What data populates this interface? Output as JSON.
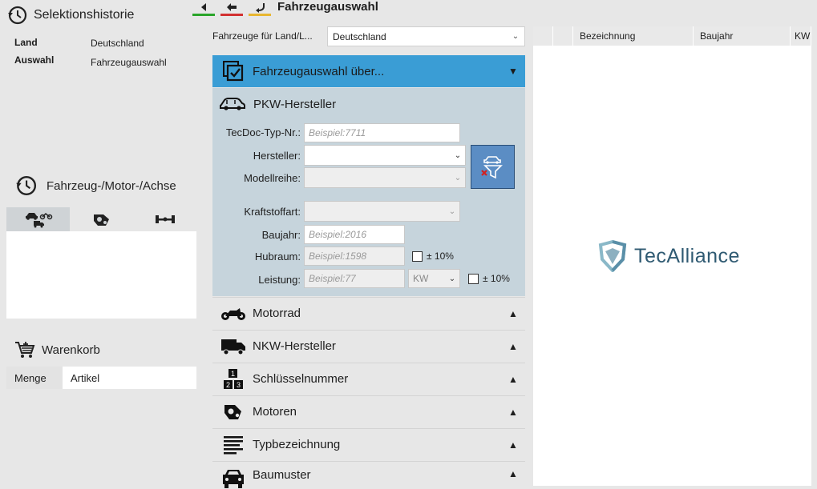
{
  "history": {
    "title": "Selektionshistorie",
    "rows": [
      {
        "key": "Land",
        "value": "Deutschland"
      },
      {
        "key": "Auswahl",
        "value": "Fahrzeugauswahl"
      }
    ]
  },
  "vehicle_history": {
    "title": "Fahrzeug-/Motor-/Achse",
    "tabs": [
      {
        "icon": "car-bike-truck-icon",
        "active": true
      },
      {
        "icon": "engine-icon",
        "active": false
      },
      {
        "icon": "axle-icon",
        "active": false
      }
    ]
  },
  "cart": {
    "title": "Warenkorb",
    "columns": [
      "Menge",
      "Artikel"
    ]
  },
  "toolbar": {
    "title": "Fahrzeugauswahl",
    "buttons": [
      {
        "icon": "play-back-icon",
        "color": "#2aa52a"
      },
      {
        "icon": "arrow-left-icon",
        "color": "#d23030"
      },
      {
        "icon": "undo-icon",
        "color": "#e8b630"
      }
    ]
  },
  "country": {
    "label": "Fahrzeuge für Land/L...",
    "value": "Deutschland"
  },
  "accordion": {
    "active_title": "Fahrzeugauswahl über...",
    "section_title": "PKW-Hersteller",
    "fields": {
      "tecdoc_label": "TecDoc-Typ-Nr.:",
      "tecdoc_placeholder": "Beispiel:7711",
      "manufacturer_label": "Hersteller:",
      "model_label": "Modellreihe:",
      "fuel_label": "Kraftstoffart:",
      "year_label": "Baujahr:",
      "year_placeholder": "Beispiel:2016",
      "displacement_label": "Hubraum:",
      "displacement_placeholder": "Beispiel:1598",
      "displacement_tolerance": "± 10%",
      "power_label": "Leistung:",
      "power_placeholder": "Beispiel:77",
      "power_unit": "KW",
      "power_tolerance": "± 10%"
    },
    "items": [
      {
        "label": "Motorrad",
        "icon": "motorcycle-icon"
      },
      {
        "label": "NKW-Hersteller",
        "icon": "truck-icon"
      },
      {
        "label": "Schlüsselnummer",
        "icon": "number-blocks-icon"
      },
      {
        "label": "Motoren",
        "icon": "engine-icon"
      },
      {
        "label": "Typbezeichnung",
        "icon": "list-lines-icon"
      },
      {
        "label": "Baumuster",
        "icon": "car-front-icon"
      }
    ]
  },
  "grid": {
    "columns": [
      "",
      "",
      "Bezeichnung",
      "Baujahr",
      "KW"
    ]
  },
  "brand": {
    "name": "TecAlliance",
    "accent": "#3a9dd5",
    "logo_colors": [
      "#5a8fa8",
      "#8ab8c8",
      "#2f6f8c"
    ]
  }
}
